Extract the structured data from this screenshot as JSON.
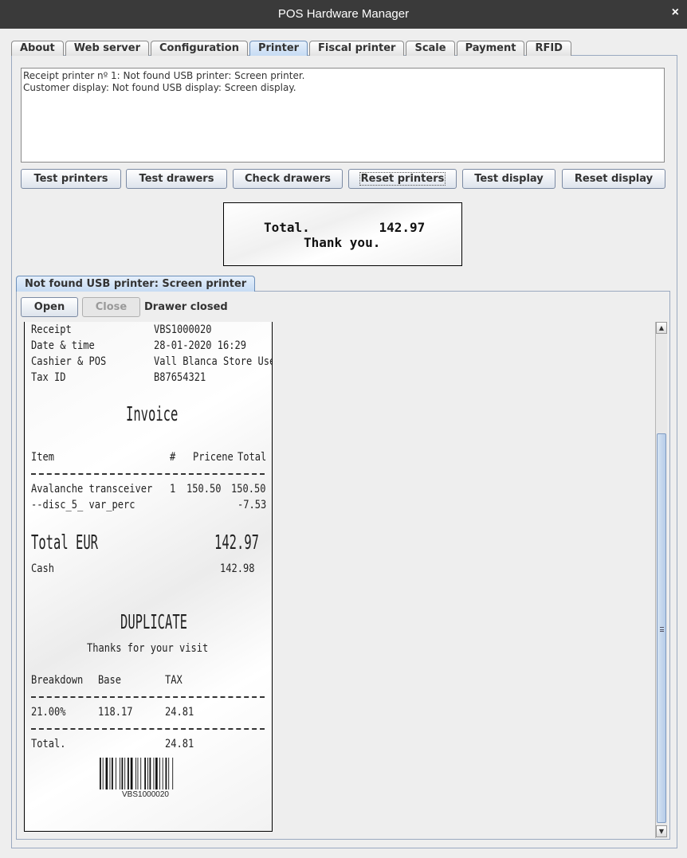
{
  "window": {
    "title": "POS Hardware Manager",
    "close_glyph": "×"
  },
  "tabs": [
    {
      "label": "About"
    },
    {
      "label": "Web server"
    },
    {
      "label": "Configuration"
    },
    {
      "label": "Printer",
      "active": true
    },
    {
      "label": "Fiscal printer"
    },
    {
      "label": "Scale"
    },
    {
      "label": "Payment"
    },
    {
      "label": "RFID"
    }
  ],
  "log": {
    "line1": "Receipt printer nº 1: Not found USB printer: Screen printer.",
    "line2": "Customer display: Not found USB display: Screen display."
  },
  "buttons": {
    "test_printers": "Test printers",
    "test_drawers": "Test drawers",
    "check_drawers": "Check drawers",
    "reset_printers": "Reset printers",
    "test_display": "Test display",
    "reset_display": "Reset display"
  },
  "customer_display": {
    "line1": "Total.         142.97",
    "line2": "Thank you."
  },
  "printer_tab": {
    "label": "Not found USB printer: Screen printer"
  },
  "drawer": {
    "open_label": "Open",
    "close_label": "Close",
    "status": "Drawer closed"
  },
  "receipt": {
    "receipt_label": "Receipt",
    "receipt_value": "VBS1000020",
    "datetime_label": "Date & time",
    "datetime_value": "28-01-2020 16:29",
    "cashier_label": "Cashier & POS",
    "cashier_value": "Vall Blanca Store Use",
    "taxid_label": "Tax ID",
    "taxid_value": "B87654321",
    "invoice_title": "Invoice",
    "col_item": "Item",
    "col_qty": "#",
    "col_price": "Pricene",
    "col_total": "Total",
    "item_name": "Avalanche transceiver",
    "item_qty": "1",
    "item_price": "150.50",
    "item_total": "150.50",
    "disc_name": "--disc_5_ var_perc",
    "disc_value": "-7.53",
    "total_label": "Total EUR",
    "total_value": "142.97",
    "cash_label": "Cash",
    "cash_value": "142.98",
    "duplicate": "DUPLICATE",
    "thanks": "Thanks for your visit",
    "bd_label": "Breakdown",
    "bd_base": "Base",
    "bd_tax": "TAX",
    "bd_rate": "21.00%",
    "bd_base_value": "118.17",
    "bd_tax_value": "24.81",
    "bd_total_label": "Total.",
    "bd_total_value": "24.81",
    "barcode_text": "VBS1000020"
  }
}
